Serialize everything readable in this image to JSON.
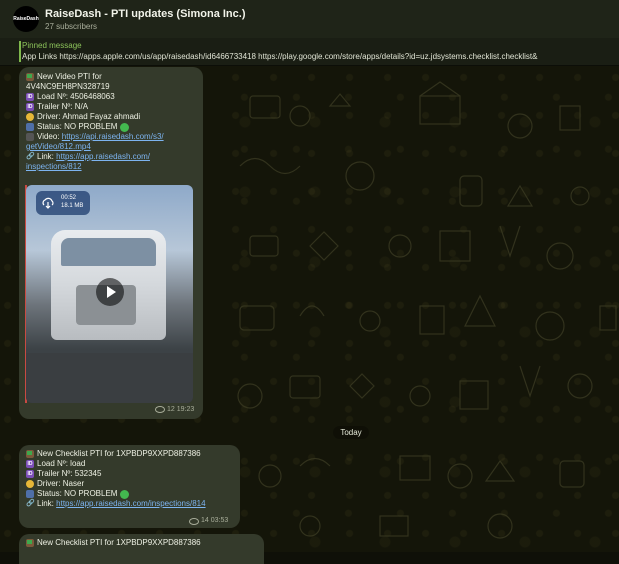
{
  "header": {
    "avatar_text": "RaiseDash",
    "title": "RaiseDash - PTI updates (Simona Inc.)",
    "subscribers": "27 subscribers"
  },
  "pinned": {
    "title": "Pinned message",
    "text": "App Links  https://apps.apple.com/us/app/raisedash/id6466733418  https://play.google.com/store/apps/details?id=uz.jdsystems.checklist.checklist&"
  },
  "messages": [
    {
      "lines": [
        "New Video PTI for",
        "4V4NC9EH8PN328719"
      ],
      "load": "Load Nº: 4506468063",
      "trailer": "Trailer Nº: N/A",
      "driver": "Driver: Ahmad Fayaz ahmadi",
      "status": "Status:  NO PROBLEM",
      "video_label": "Video: ",
      "video_link_1": "https://api.raisedash.com/s3/",
      "video_link_2": "getVideo/812.mp4",
      "link_label": "Link: ",
      "link_1": "https://app.raisedash.com/",
      "link_2": "inspections/812",
      "video_duration": "00:52",
      "video_size": "18.1 MB",
      "time": "12 19:23"
    },
    {
      "title": "New Checklist PTI for 1XPBDP9XXPD887386",
      "load": "Load Nº: load",
      "trailer": "Trailer Nº: 532345",
      "driver": "Driver: Naser",
      "status": "Status:  NO PROBLEM",
      "link_label": "Link: ",
      "link": "https://app.raisedash.com/inspections/814",
      "time": "14 03:53"
    },
    {
      "title": "New Checklist PTI for 1XPBDP9XXPD887386"
    }
  ],
  "divider": "Today",
  "colors": {
    "bubble": "#343a2b",
    "accent": "#8cc35a",
    "link": "#7db4f0",
    "status_ok": "#43b84f"
  }
}
